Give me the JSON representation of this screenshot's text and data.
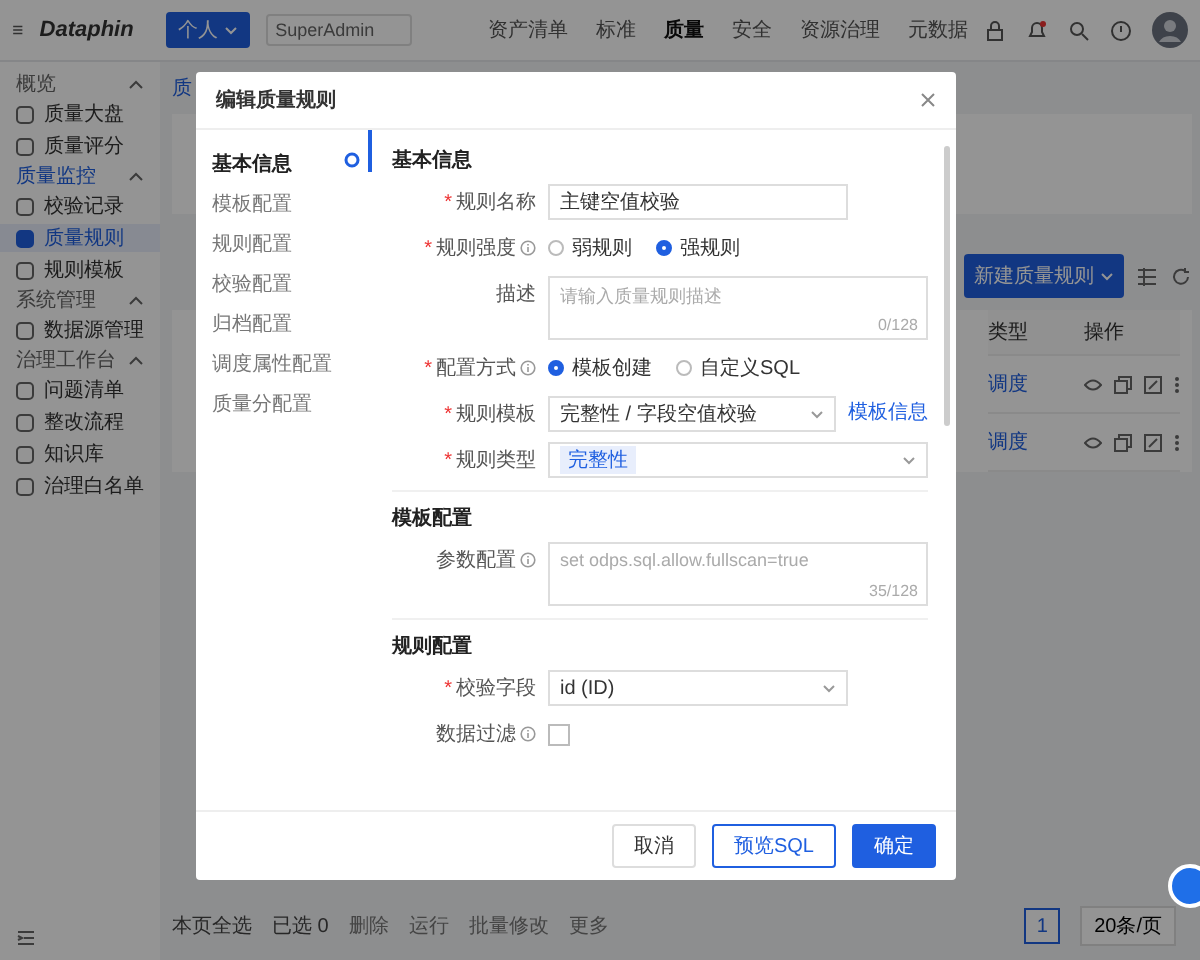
{
  "topbar": {
    "logo": "Dataphin",
    "space": "个人",
    "project": "SuperAdmin",
    "nav": [
      {
        "label": "资产清单",
        "selected": false
      },
      {
        "label": "标准",
        "selected": false
      },
      {
        "label": "质量",
        "selected": true
      },
      {
        "label": "安全",
        "selected": false
      },
      {
        "label": "资源治理",
        "selected": false
      },
      {
        "label": "元数据",
        "selected": false
      }
    ]
  },
  "sidebar": {
    "groups": [
      {
        "title": "概览",
        "expanded": true,
        "items": [
          {
            "label": "质量大盘",
            "selected": false
          },
          {
            "label": "质量评分",
            "selected": false
          }
        ]
      },
      {
        "title": "质量监控",
        "expanded": true,
        "items": [
          {
            "label": "校验记录",
            "selected": false
          },
          {
            "label": "质量规则",
            "selected": true
          },
          {
            "label": "规则模板",
            "selected": false
          }
        ]
      },
      {
        "title": "系统管理",
        "expanded": true,
        "items": [
          {
            "label": "数据源管理",
            "selected": false
          }
        ]
      },
      {
        "title": "治理工作台",
        "expanded": true,
        "items": [
          {
            "label": "问题清单",
            "selected": false
          },
          {
            "label": "整改流程",
            "selected": false
          },
          {
            "label": "知识库",
            "selected": false
          },
          {
            "label": "治理白名单",
            "selected": false
          }
        ]
      }
    ]
  },
  "main": {
    "breadcrumb": "质",
    "new_button": "新建质量规则",
    "table": {
      "columns": [
        "类型",
        "操作"
      ],
      "rows": [
        {
          "type": "调度"
        },
        {
          "type": "调度"
        }
      ]
    }
  },
  "bottom_bar": {
    "select_all": "本页全选",
    "selected_count": "已选 0",
    "actions": [
      "删除",
      "运行",
      "批量修改",
      "更多"
    ]
  },
  "pagination": {
    "page": "1",
    "page_size": "20条/页"
  },
  "modal": {
    "title": "编辑质量规则",
    "nav": [
      {
        "label": "基本信息",
        "selected": true
      },
      {
        "label": "模板配置",
        "selected": false
      },
      {
        "label": "规则配置",
        "selected": false
      },
      {
        "label": "校验配置",
        "selected": false
      },
      {
        "label": "归档配置",
        "selected": false
      },
      {
        "label": "调度属性配置",
        "selected": false
      },
      {
        "label": "质量分配置",
        "selected": false
      }
    ],
    "sections": [
      {
        "title": "基本信息",
        "rows": [
          {
            "kind": "input",
            "mark": "*",
            "label": "规则名称",
            "value": "主键空值校验"
          },
          {
            "kind": "radio",
            "mark": "*",
            "label": "规则强度",
            "info": true,
            "options": [
              {
                "label": "弱规则",
                "selected": false
              },
              {
                "label": "强规则",
                "selected": true
              }
            ]
          },
          {
            "kind": "textarea",
            "label": "描述",
            "placeholder": "请输入质量规则描述",
            "counter": "0/128"
          },
          {
            "kind": "radio",
            "mark": "*",
            "label": "配置方式",
            "info": true,
            "options": [
              {
                "label": "模板创建",
                "selected": true
              },
              {
                "label": "自定义SQL",
                "selected": false
              }
            ]
          },
          {
            "kind": "select",
            "mark": "*",
            "label": "规则模板",
            "value": "完整性 / 字段空值校验",
            "link": "模板信息"
          },
          {
            "kind": "tag-select",
            "mark": "*",
            "label": "规则类型",
            "tag": "完整性"
          }
        ]
      },
      {
        "title": "模板配置",
        "rows": [
          {
            "kind": "textarea",
            "label": "参数配置",
            "info": true,
            "placeholder": "set odps.sql.allow.fullscan=true",
            "counter": "35/128"
          }
        ]
      },
      {
        "title": "规则配置",
        "rows": [
          {
            "kind": "select",
            "mark": "*",
            "label": "校验字段",
            "value": "id (ID)"
          },
          {
            "kind": "checkbox",
            "label": "数据过滤",
            "info": true,
            "checked": false
          }
        ]
      }
    ],
    "buttons": [
      {
        "label": "取消",
        "kind": "default"
      },
      {
        "label": "预览SQL",
        "kind": "outline"
      },
      {
        "label": "确定",
        "kind": "primary"
      }
    ]
  }
}
